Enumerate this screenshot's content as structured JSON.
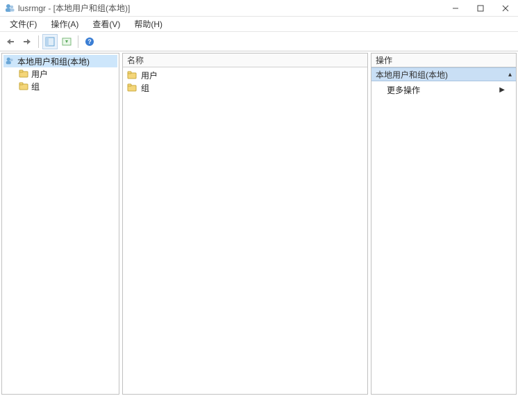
{
  "window": {
    "title": "lusrmgr - [本地用户和组(本地)]"
  },
  "menu": {
    "file": "文件(F)",
    "action": "操作(A)",
    "view": "查看(V)",
    "help": "帮助(H)"
  },
  "tree": {
    "root": "本地用户和组(本地)",
    "users": "用户",
    "groups": "组"
  },
  "middle": {
    "header_name": "名称",
    "items": {
      "users": "用户",
      "groups": "组"
    }
  },
  "actions": {
    "header": "操作",
    "group_title": "本地用户和组(本地)",
    "more_actions": "更多操作"
  }
}
